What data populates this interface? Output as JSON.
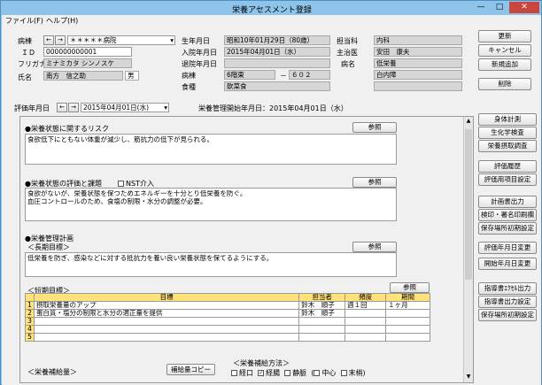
{
  "window": {
    "title": "栄養アセスメント登録"
  },
  "menu": {
    "file": "ファイル(F)",
    "help": "ヘルプ(H)"
  },
  "patient": {
    "ward_label": "病棟",
    "ward_value": "＊＊＊＊＊病院",
    "id_label": "ＩＤ",
    "id_value": "000000000001",
    "kana_label": "フリガナ",
    "kana_value": "ミナミカタ シンノスケ",
    "name_label": "氏名",
    "name_value": "南方　信之助",
    "sex": "男",
    "dob_label": "生年月日",
    "dob_value": "昭和10年01月29日（80歳）",
    "admit_label": "入院年月日",
    "admit_value": "2015年04月01日（水）",
    "discharge_label": "退院年月日",
    "discharge_value": "",
    "ward2_label": "病棟",
    "ward2_value": "6階東",
    "room_sep": "－",
    "room_value": "６０２",
    "diet_label": "食種",
    "diet_value": "軟菜食",
    "dept_label": "担当科",
    "dept_value": "内科",
    "doctor_label": "主治医",
    "doctor_value": "安田　康夫",
    "disease_label": "病名",
    "disease_value1": "低栄養",
    "disease_value2": "白内障"
  },
  "eval": {
    "label": "評価年月日",
    "date": "2015年04月01日(水)",
    "start": "栄養管理開始年月日：2015年04月01日（水）"
  },
  "sections": {
    "risk_title": "●栄養状態に関するリスク",
    "risk_text": "食欲低下にともない体重が減少し、筋抗力の低下が見られる。",
    "assess_title": "●栄養状態の評価と課題",
    "nst_label": "NST介入",
    "assess_text1": "食欲がないが、栄養状態を保つためエネルギーを十分とり低栄養を防ぐ。",
    "assess_text2": "血圧コントロールのため、食塩の制限・水分の調整が必要。",
    "plan_title": "●栄養管理計画",
    "long_label": "＜長期目標＞",
    "long_text": "低栄養を防ぎ、感染などに対する抵抗力を養い良い栄養状態を保てるようにする。",
    "short_label": "＜短期目標＞",
    "ref": "参照",
    "supply_label": "＜栄養補給量＞",
    "supply_copy": "補給量コピー",
    "method_label": "＜栄養補給方法＞",
    "methods": [
      "経口",
      "経腸",
      "静脈",
      "中心",
      "末梢"
    ]
  },
  "goals": {
    "headers": [
      "",
      "目標",
      "担当者",
      "頻度",
      "期間"
    ],
    "rows": [
      {
        "n": "1",
        "goal": "摂取栄養量のアップ",
        "staff": "鈴木　順子",
        "freq": "週１回",
        "period": "１ヶ月"
      },
      {
        "n": "2",
        "goal": "蛋白質・塩分の制限と水分の適正量を提供",
        "staff": "鈴木　順子",
        "freq": "",
        "period": ""
      },
      {
        "n": "3",
        "goal": "",
        "staff": "",
        "freq": "",
        "period": ""
      },
      {
        "n": "4",
        "goal": "",
        "staff": "",
        "freq": "",
        "period": ""
      },
      {
        "n": "5",
        "goal": "",
        "staff": "",
        "freq": "",
        "period": ""
      }
    ]
  },
  "buttons": {
    "update": "更新",
    "cancel": "キャンセル",
    "new": "新規追加",
    "delete": "削除",
    "body": "身体計測",
    "biochem": "生化学検査",
    "intake": "栄養摂取調査",
    "history": "評価履歴",
    "eval_items": "評価用項目設定",
    "plan_print": "計画書出力",
    "print_sign": "検印・署名印刷欄",
    "save_init": "保存場所初期設定",
    "eval_change": "評価年月日変更",
    "start_change": "開始年月日変更",
    "guide_excel": "指導書ｴｸｾﾙ出力",
    "guide_out": "指導書出力設定",
    "save_init2": "保存場所初期設定"
  }
}
